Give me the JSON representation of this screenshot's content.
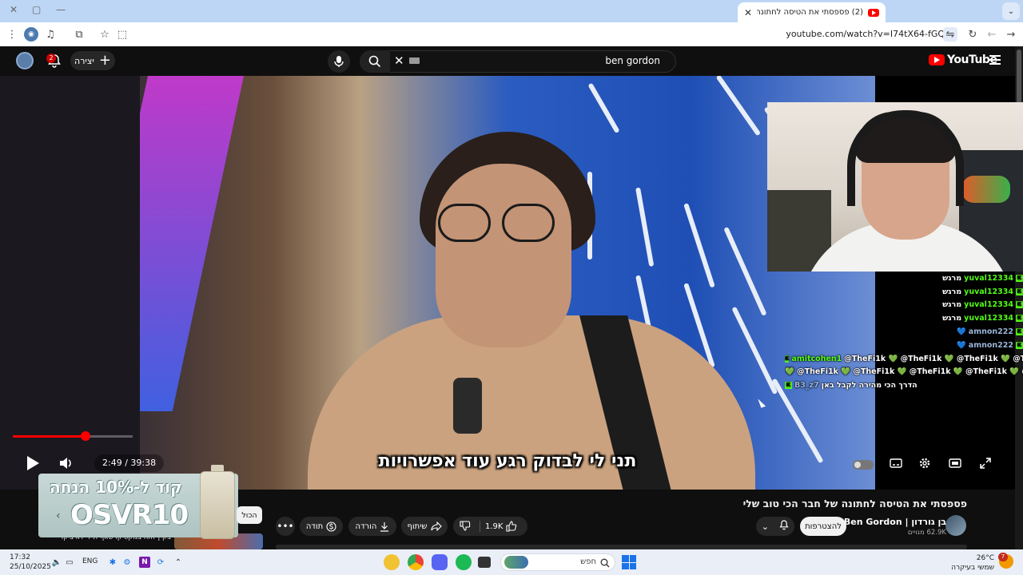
{
  "browser": {
    "tab_title": "(2) פספסתי את הטיסה לחתונה",
    "new_tab": "+",
    "url": "youtube.com/watch?v=I74tX64-fGQ"
  },
  "youtube": {
    "logo_text": "YouTube",
    "search_query": "ben gordon",
    "create_label": "יצירה",
    "notification_count": "2"
  },
  "player": {
    "current_time": "2:49",
    "duration": "39:38",
    "time_display": "2:49 / 39:38",
    "progress_fraction": 0.071,
    "subtitle": "תני לי לבדוק רגע עוד אפשרויות"
  },
  "stream_overlay": {
    "chat": [
      {
        "user": "yuval12334",
        "message": "מרגש"
      },
      {
        "user": "yuval12334",
        "message": "מרגש"
      },
      {
        "user": "yuval12334",
        "message": "מרגש"
      },
      {
        "user": "yuval12334",
        "message": "מרגש"
      },
      {
        "user": "amnon222",
        "message": "💙"
      },
      {
        "user": "amnon222",
        "message": "💙"
      },
      {
        "user": "amitcohen1",
        "message": "@TheFi1k 💚 @TheFi1k 💚 @TheFi1k 💚 @TheFi1k"
      },
      {
        "user": "",
        "message": "💚 @TheFi1k 💚 @TheFi1k 💚 @TheFi1k 💚 @TheFi1k 💚 @TheFi1k"
      },
      {
        "user": "B3_z7",
        "message": "הדרך הכי מהירה לקבל באן"
      }
    ]
  },
  "video": {
    "title": "פספסתי את הטיסה לחתונה של חבר הכי טוב שלי",
    "channel_name": "Ben Gordon | בן גורדון",
    "subscribers": "62.9K מנויים",
    "join_label": "להצטרפות",
    "likes": "1.9K",
    "share_label": "שיתוף",
    "download_label": "הורדה",
    "thanks_label": "תודה"
  },
  "promo": {
    "headline": "קוד ל-10% הנחה",
    "code": "OSVR10"
  },
  "related": {
    "chip_all": "הכול",
    "first_title": "בקיץ הזה במקסיקו שאף תייר לא ביקר"
  },
  "taskbar": {
    "time": "17:32",
    "date": "25/10/2025",
    "language": "ENG",
    "search_placeholder": "חפש",
    "temperature": "26°C",
    "weather_desc": "שמשי בעיקרה",
    "weather_badge": "7"
  }
}
